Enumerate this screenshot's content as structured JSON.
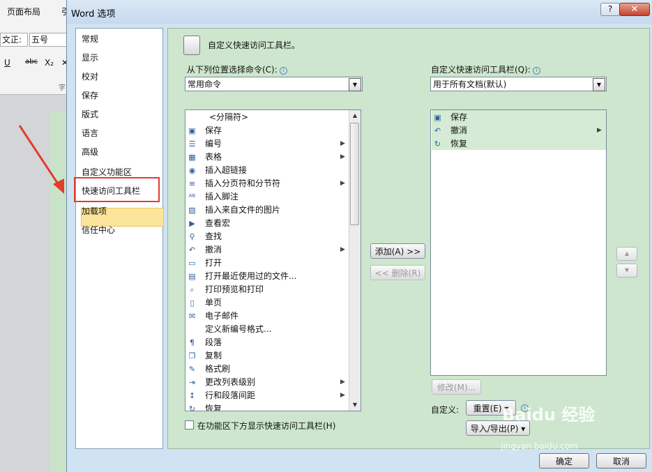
{
  "background": {
    "tabs": [
      "页面布局",
      "引"
    ],
    "font_name": "文正:",
    "font_size": "五号",
    "format_buttons": [
      "U",
      "abc",
      "X₂",
      "✕"
    ],
    "group_label": "字"
  },
  "dialog": {
    "title": "Word 选项",
    "help_label": "?",
    "close_label": "✕",
    "nav_items": [
      "常规",
      "显示",
      "校对",
      "保存",
      "版式",
      "语言",
      "高级",
      "自定义功能区",
      "快速访问工具栏",
      "加载项",
      "信任中心"
    ],
    "selected_nav": "快速访问工具栏",
    "header": "自定义快速访问工具栏。",
    "choose_label": "从下列位置选择命令(C):",
    "choose_value": "常用命令",
    "customize_label": "自定义快速访问工具栏(Q):",
    "customize_value": "用于所有文档(默认)",
    "commands": [
      {
        "icon": "",
        "label": "<分隔符>",
        "sub": false
      },
      {
        "icon": "save-icon",
        "label": "保存",
        "sub": false
      },
      {
        "icon": "numbering-icon",
        "label": "编号",
        "sub": true
      },
      {
        "icon": "table-icon",
        "label": "表格",
        "sub": true
      },
      {
        "icon": "hyperlink-icon",
        "label": "插入超链接",
        "sub": false
      },
      {
        "icon": "page-break-icon",
        "label": "插入分页符和分节符",
        "sub": true
      },
      {
        "icon": "footnote-icon",
        "label": "插入脚注",
        "sub": false
      },
      {
        "icon": "picture-icon",
        "label": "插入来自文件的图片",
        "sub": false
      },
      {
        "icon": "macro-icon",
        "label": "查看宏",
        "sub": false
      },
      {
        "icon": "find-icon",
        "label": "查找",
        "sub": false
      },
      {
        "icon": "undo-icon",
        "label": "撤消",
        "sub": true
      },
      {
        "icon": "open-icon",
        "label": "打开",
        "sub": false
      },
      {
        "icon": "recent-icon",
        "label": "打开最近使用过的文件...",
        "sub": false
      },
      {
        "icon": "print-preview-icon",
        "label": "打印预览和打印",
        "sub": false
      },
      {
        "icon": "single-page-icon",
        "label": "单页",
        "sub": false
      },
      {
        "icon": "email-icon",
        "label": "电子邮件",
        "sub": false
      },
      {
        "icon": "",
        "label": "定义新编号格式...",
        "sub": false
      },
      {
        "icon": "paragraph-icon",
        "label": "段落",
        "sub": false
      },
      {
        "icon": "copy-icon",
        "label": "复制",
        "sub": false
      },
      {
        "icon": "format-painter-icon",
        "label": "格式刷",
        "sub": false
      },
      {
        "icon": "list-level-icon",
        "label": "更改列表级别",
        "sub": true
      },
      {
        "icon": "line-spacing-icon",
        "label": "行和段落间距",
        "sub": true
      },
      {
        "icon": "redo-icon",
        "label": "恢复",
        "sub": false
      }
    ],
    "toolbar_items": [
      {
        "icon": "save-icon",
        "label": "保存",
        "sub": false
      },
      {
        "icon": "undo-icon",
        "label": "撤消",
        "sub": true
      },
      {
        "icon": "redo-icon",
        "label": "恢复",
        "sub": false
      }
    ],
    "add_button": "添加(A) >>",
    "remove_button": "<< 删除(R)",
    "modify_button": "修改(M)...",
    "custom_label": "自定义:",
    "reset_button": "重置(E) ▾",
    "import_export_button": "导入/导出(P) ▾",
    "show_below_label": "在功能区下方显示快速访问工具栏(H)",
    "ok_button": "确定",
    "cancel_button": "取消"
  },
  "watermark": {
    "text": "Baidu 经验",
    "url": "jingyan.baidu.com"
  },
  "colors": {
    "content_bg": "#cde6cd",
    "selected_nav": "#fbe59a",
    "highlight_box": "#e23c2f"
  }
}
